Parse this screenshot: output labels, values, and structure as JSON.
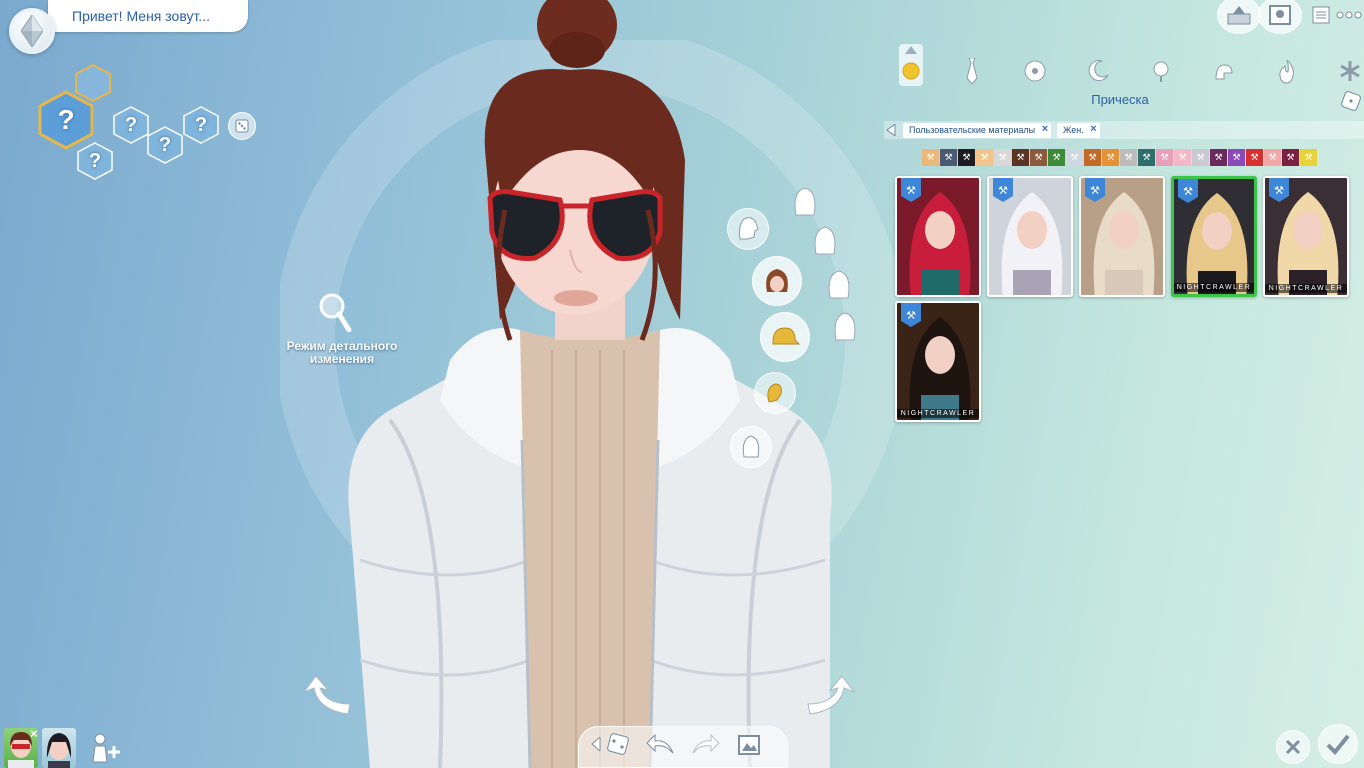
{
  "header": {
    "name_prompt": "Привет! Меня зовут...",
    "plumbob_icon": "plumbob-icon"
  },
  "traits": {
    "placeholder": "?",
    "count": 6
  },
  "detail_mode": {
    "label": "Режим детального изменения"
  },
  "panel": {
    "title": "Прическа",
    "filters": [
      {
        "label": "Пользовательские материалы"
      },
      {
        "label": "Жен."
      }
    ],
    "swatch_colors": [
      "#e9b87a",
      "#4b5a72",
      "#1c1c22",
      "#f0c48a",
      "#d8d8d8",
      "#5a3524",
      "#8c5a3c",
      "#3e8a3a",
      "#cfd7e0",
      "#c26a28",
      "#e79036",
      "#bcbcbc",
      "#2f6f6a",
      "#e8a0b8",
      "#f2b8c8",
      "#c9c9d2",
      "#6b2a5a",
      "#8a4ab8",
      "#d8302e",
      "#f0a8a8",
      "#7a2040",
      "#e8d23a"
    ],
    "items": [
      {
        "name": "hair-red-long",
        "label": "",
        "selected": false,
        "custom": true
      },
      {
        "name": "hair-white-wavy",
        "label": "",
        "selected": false,
        "custom": true
      },
      {
        "name": "hair-blonde-curly",
        "label": "",
        "selected": false,
        "custom": true
      },
      {
        "name": "hair-bun-bangs",
        "label": "NIGHTCRAWLER",
        "selected": true,
        "custom": true
      },
      {
        "name": "hair-platinum-straight",
        "label": "NIGHTCRAWLER",
        "selected": false,
        "custom": true
      },
      {
        "name": "hair-braids-dark",
        "label": "NIGHTCRAWLER",
        "selected": false,
        "custom": true
      }
    ]
  },
  "colors": {
    "accent": "#2a5fa6",
    "selected": "#3cc34a",
    "badge": "#3d86d8"
  }
}
